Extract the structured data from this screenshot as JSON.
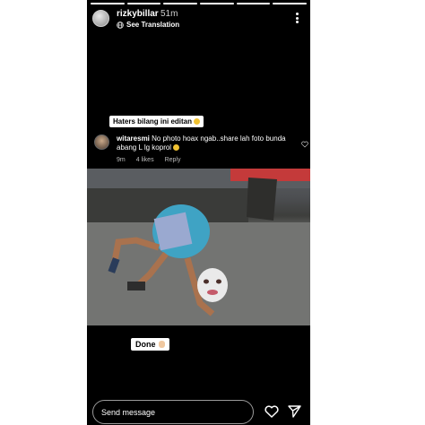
{
  "story": {
    "username": "rizkybillar",
    "time": "51m",
    "translate_label": "See Translation",
    "progress_segments": 6,
    "progress_done": 6
  },
  "caption_tag": "Haters bilang ini editan",
  "comment": {
    "username": "witaresmi",
    "text": "No photo hoax ngab..share lah foto bunda abang L lg koprol",
    "time": "9m",
    "likes": "4 likes",
    "reply_label": "Reply"
  },
  "done_tag": "Done",
  "composer": {
    "placeholder": "Send message"
  },
  "icons": {
    "more": "more-vertical-icon",
    "translate": "globe-icon",
    "like": "heart-icon",
    "send": "paper-plane-icon"
  },
  "colors": {
    "background": "#000000",
    "tag_background": "#ffffff",
    "meta_text": "#bbbbbb"
  }
}
